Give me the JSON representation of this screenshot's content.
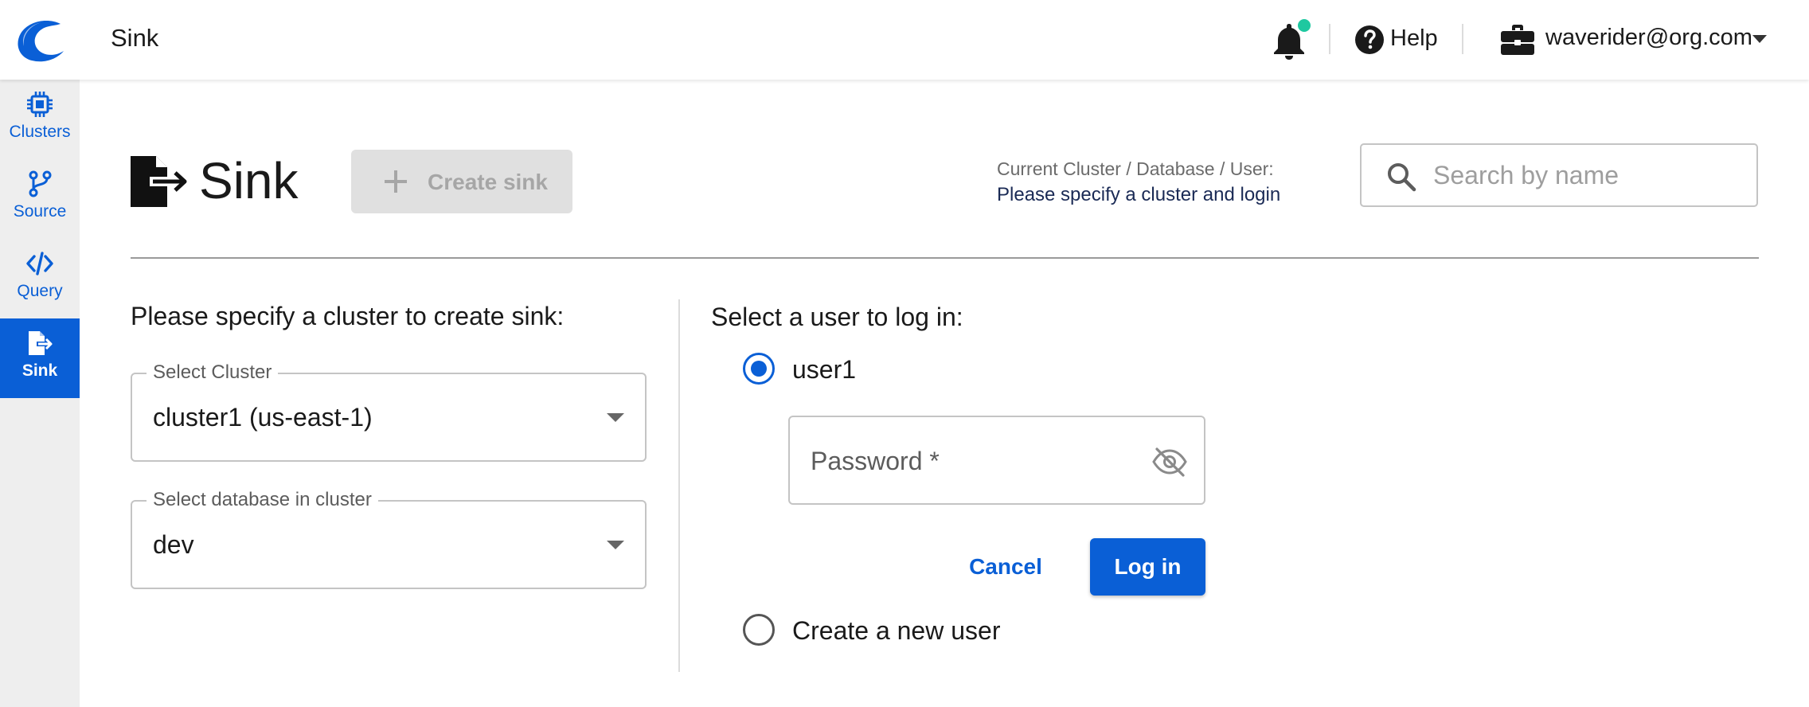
{
  "app": {
    "title": "Sink",
    "logo_icon": "wave-logo-icon",
    "brand_color": "#0a5fd6"
  },
  "header": {
    "notifications_icon": "bell-icon",
    "notification_dot_color": "#1ec8a0",
    "help_label": "Help",
    "user_email": "waverider@org.com"
  },
  "sidebar": {
    "items": [
      {
        "label": "Clusters",
        "icon": "chip-icon",
        "active": false
      },
      {
        "label": "Source",
        "icon": "branch-icon",
        "active": false
      },
      {
        "label": "Query",
        "icon": "code-icon",
        "active": false
      },
      {
        "label": "Sink",
        "icon": "file-export-icon",
        "active": true
      }
    ]
  },
  "page": {
    "title": "Sink",
    "create_button_label": "Create sink",
    "context_label": "Current Cluster / Database / User:",
    "context_value": "Please specify a cluster and login",
    "search_placeholder": "Search by name"
  },
  "cluster_panel": {
    "heading": "Please specify a cluster to create sink:",
    "cluster_select_label": "Select Cluster",
    "cluster_select_value": "cluster1 (us-east-1)",
    "database_select_label": "Select database in cluster",
    "database_select_value": "dev"
  },
  "login_panel": {
    "heading": "Select a user to log in:",
    "user_option_label": "user1",
    "password_placeholder": "Password *",
    "cancel_label": "Cancel",
    "login_label": "Log in",
    "new_user_option_label": "Create a new user"
  }
}
